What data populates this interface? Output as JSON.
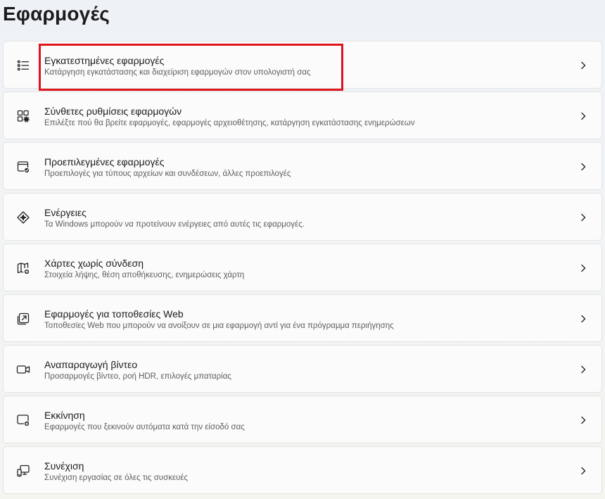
{
  "page": {
    "title": "Εφαρμογές"
  },
  "items": [
    {
      "icon": "list-icon",
      "title": "Εγκατεστημένες εφαρμογές",
      "subtitle": "Κατάργηση εγκατάστασης και διαχείριση εφαρμογών στον υπολογιστή σας"
    },
    {
      "icon": "app-settings-icon",
      "title": "Σύνθετες ρυθμίσεις εφαρμογών",
      "subtitle": "Επιλέξτε πού θα βρείτε εφαρμογές, εφαρμογές αρχειοθέτησης, κατάργηση εγκατάστασης ενημερώσεων"
    },
    {
      "icon": "default-apps-icon",
      "title": "Προεπιλεγμένες εφαρμογές",
      "subtitle": "Προεπιλογές για τύπους αρχείων και συνδέσεων, άλλες προεπιλογές"
    },
    {
      "icon": "actions-sparkle-icon",
      "title": "Ενέργειες",
      "subtitle": "Τα Windows μπορούν να προτείνουν ενέργειες από αυτές τις εφαρμογές."
    },
    {
      "icon": "offline-map-icon",
      "title": "Χάρτες χωρίς σύνδεση",
      "subtitle": "Στοιχεία λήψης, θέση αποθήκευσης, ενημερώσεις χάρτη"
    },
    {
      "icon": "open-external-icon",
      "title": "Εφαρμογές για τοποθεσίες Web",
      "subtitle": "Τοποθεσίες Web που μπορούν να ανοίξουν σε μια εφαρμογή αντί για ένα πρόγραμμα περιήγησης"
    },
    {
      "icon": "video-camera-icon",
      "title": "Αναπαραγωγή βίντεο",
      "subtitle": "Προσαρμογές βίντεο, ροή HDR, επιλογές μπαταρίας"
    },
    {
      "icon": "startup-icon",
      "title": "Εκκίνηση",
      "subtitle": "Εφαρμογές που ξεκινούν αυτόματα κατά την είσοδό σας"
    },
    {
      "icon": "continuity-devices-icon",
      "title": "Συνέχιση",
      "subtitle": "Συνέχιση εργασίας σε όλες τις συσκευές"
    }
  ],
  "colors": {
    "highlight": "#e0141e",
    "card_background": "#fbfbfb",
    "subtitle_text": "#5d5d5d"
  },
  "highlighted_item_index": 0
}
